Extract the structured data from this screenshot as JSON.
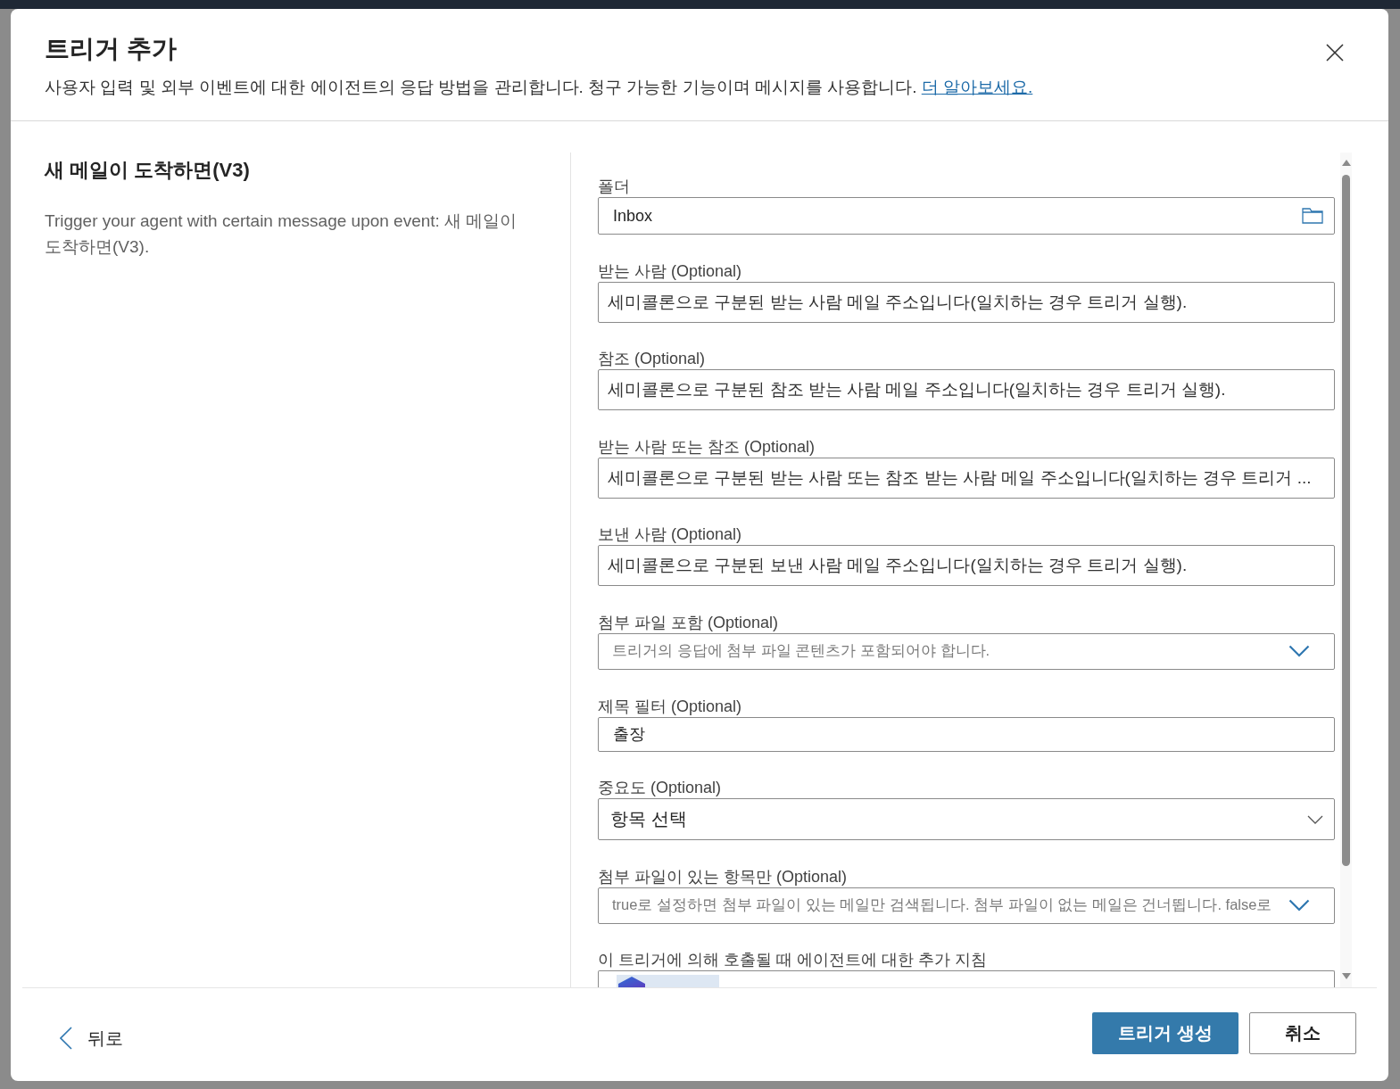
{
  "dialog": {
    "title": "트리거 추가",
    "description": "사용자 입력 및 외부 이벤트에 대한 에이전트의 응답 방법을 관리합니다. 청구 가능한 기능이며 메시지를 사용합니다.",
    "learn_more_link": "더 알아보세요."
  },
  "trigger": {
    "name": "새 메일이 도착하면(V3)",
    "description": "Trigger your agent with certain message upon event: 새 메일이 도착하면(V3)."
  },
  "fields": [
    {
      "kind": "folder",
      "label": "폴더",
      "value": "Inbox"
    },
    {
      "kind": "text",
      "label": "받는 사람 (Optional)",
      "placeholder": "세미콜론으로 구분된 받는 사람 메일 주소입니다(일치하는 경우 트리거 실행)."
    },
    {
      "kind": "text",
      "label": "참조 (Optional)",
      "placeholder": "세미콜론으로 구분된 참조 받는 사람 메일 주소입니다(일치하는 경우 트리거 실행)."
    },
    {
      "kind": "text",
      "label": "받는 사람 또는 참조 (Optional)",
      "placeholder": "세미콜론으로 구분된 받는 사람 또는 참조 받는 사람 메일 주소입니다(일치하는 경우 트리거 ..."
    },
    {
      "kind": "text",
      "label": "보낸 사람 (Optional)",
      "placeholder": "세미콜론으로 구분된 보낸 사람 메일 주소입니다(일치하는 경우 트리거 실행)."
    },
    {
      "kind": "select",
      "label": "첨부 파일 포함 (Optional)",
      "placeholder": "트리거의 응답에 첨부 파일 콘텐츠가 포함되어야 합니다."
    },
    {
      "kind": "text",
      "label": "제목 필터 (Optional)",
      "value": "출장"
    },
    {
      "kind": "dropdown",
      "label": "중요도 (Optional)",
      "placeholder": "항목 선택"
    },
    {
      "kind": "select",
      "label": "첨부 파일이 있는 항목만 (Optional)",
      "placeholder": "true로 설정하면 첨부 파일이 있는 메일만 검색됩니다. 첨부 파일이 없는 메일은 건너뜁니다. false로"
    },
    {
      "kind": "editor",
      "label": "이 트리거에 의해 호출될 때 에이전트에 대한 추가 지침"
    }
  ],
  "footer": {
    "back": "뒤로",
    "buttons": [
      {
        "kind": "primary",
        "label": "트리거 생성"
      },
      {
        "kind": "secondary",
        "label": "취소"
      }
    ]
  }
}
